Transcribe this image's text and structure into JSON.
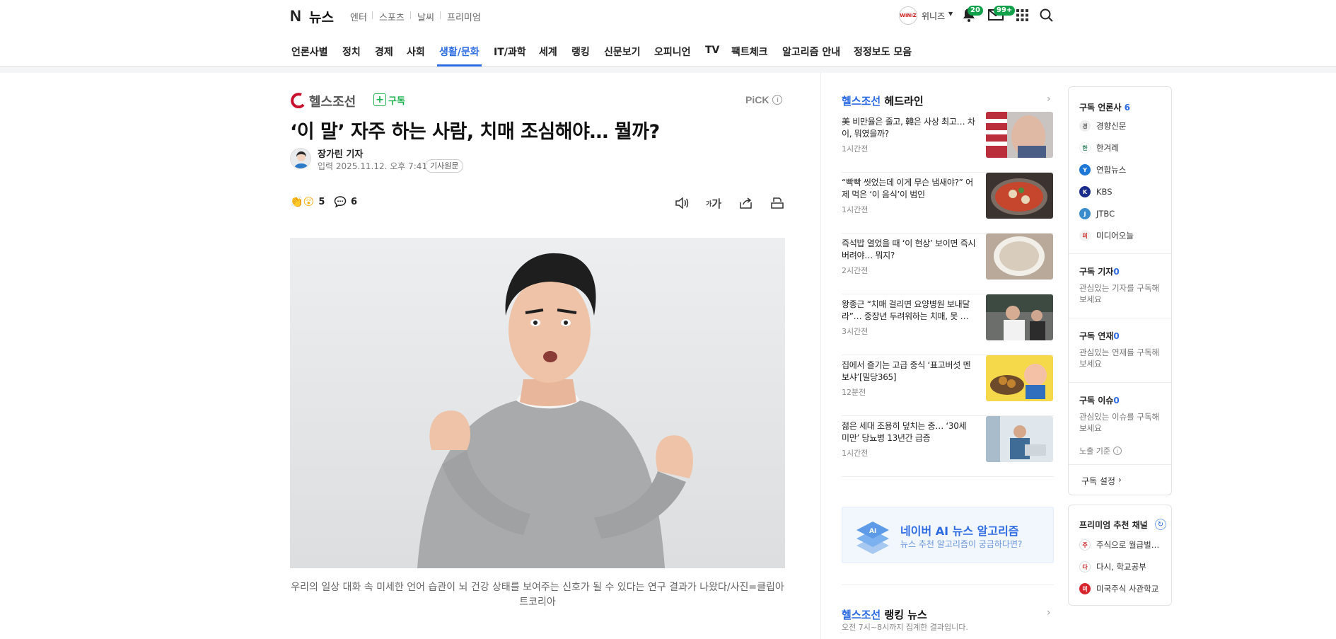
{
  "header": {
    "logo_n": "N",
    "logo_text": "뉴스",
    "services": [
      "엔터",
      "스포츠",
      "날씨",
      "프리미엄"
    ],
    "user_name": "위니즈",
    "user_avatar_text": "WiNiZ",
    "notification_count": "20",
    "mail_count": "99+"
  },
  "nav": {
    "items": [
      "언론사별",
      "정치",
      "경제",
      "사회",
      "생활/문화",
      "IT/과학",
      "세계",
      "랭킹",
      "신문보기",
      "오피니언",
      "TV",
      "팩트체크",
      "알고리즘 안내",
      "정정보도 모음"
    ],
    "active": "생활/문화"
  },
  "article": {
    "press": "헬스조선",
    "subscribe_label": "구독",
    "pick_label": "PiCK",
    "title": "‘이 말’ 자주 하는 사람, 치매 조심해야… 뭘까?",
    "reporter": "장가린 기자",
    "date": "입력 2025.11.12. 오후 7:41",
    "original_label": "기사원문",
    "reaction_count": "5",
    "comment_count": "6",
    "font_size_label": "가",
    "caption": "우리의 일상 대화 속 미세한 언어 습관이 뇌 건강 상태를 보여주는 신호가 될 수 있다는 연구 결과가 나왔다/사진=클립아트코리아"
  },
  "headlines": {
    "press": "헬스조선",
    "title_suffix": " 헤드라인",
    "items": [
      {
        "title": "美 비만율은 줄고, 韓은 사상 최고… 차이, 뭐였을까?",
        "time": "1시간전"
      },
      {
        "title": "“빡빡 씻었는데 이게 무슨 냄새야?” 어제 먹은 ‘이 음식’이 범인",
        "time": "1시간전"
      },
      {
        "title": "즉석밥 열었을 때 ‘이 현상’ 보이면 즉시 버려야… 뭐지?",
        "time": "2시간전"
      },
      {
        "title": "왕종근 “치매 걸리면 요양병원 보내달라”… 중장년 두려워하는 치매, 못 …",
        "time": "3시간전"
      },
      {
        "title": "집에서 즐기는 고급 중식 ‘표고버섯 멘보샤’[밀당365]",
        "time": "12분전"
      },
      {
        "title": "젊은 세대 조용히 덮치는 중… ‘30세 미만’ 당뇨병 13년간 급증",
        "time": "1시간전"
      }
    ]
  },
  "ai_banner": {
    "title": "네이버 AI 뉴스 알고리즘",
    "subtitle": "뉴스 추천 알고리즘이 궁금하다면?",
    "icon_text": "AI"
  },
  "ranking": {
    "press": "헬스조선",
    "title_suffix": " 랭킹 뉴스",
    "subtitle": "오전 7시~8시까지 집계한 결과입니다."
  },
  "subscribe_panel": {
    "press_title": "구독 언론사",
    "press_count": "6",
    "presses": [
      {
        "name": "경향신문",
        "color": "#e9e9e9"
      },
      {
        "name": "한겨레",
        "color": "#ffffff"
      },
      {
        "name": "연합뉴스",
        "color": "#1e78d7"
      },
      {
        "name": "KBS",
        "color": "#1a2c8c"
      },
      {
        "name": "JTBC",
        "color": "#3b8ccc"
      },
      {
        "name": "미디어오늘",
        "color": "#f2f2f2"
      }
    ],
    "reporter_title": "구독 기자",
    "reporter_count": "0",
    "reporter_desc": "관심있는 기자를 구독해보세요",
    "series_title": "구독 연재",
    "series_count": "0",
    "series_desc": "관심있는 연재를 구독해보세요",
    "issue_title": "구독 이슈",
    "issue_count": "0",
    "issue_desc": "관심있는 이슈를 구독해보세요",
    "exposure_label": "노출 기준",
    "settings_label": "구독 설정"
  },
  "premium_panel": {
    "title": "프리미엄 추천 채널",
    "channels": [
      "주식으로 월급벌…",
      "다시, 학교공부",
      "미국주식 사관학교"
    ]
  },
  "colors": {
    "accent": "#2d6be3",
    "subscribe_green": "#1db24f",
    "badge_green": "#11a14a"
  }
}
